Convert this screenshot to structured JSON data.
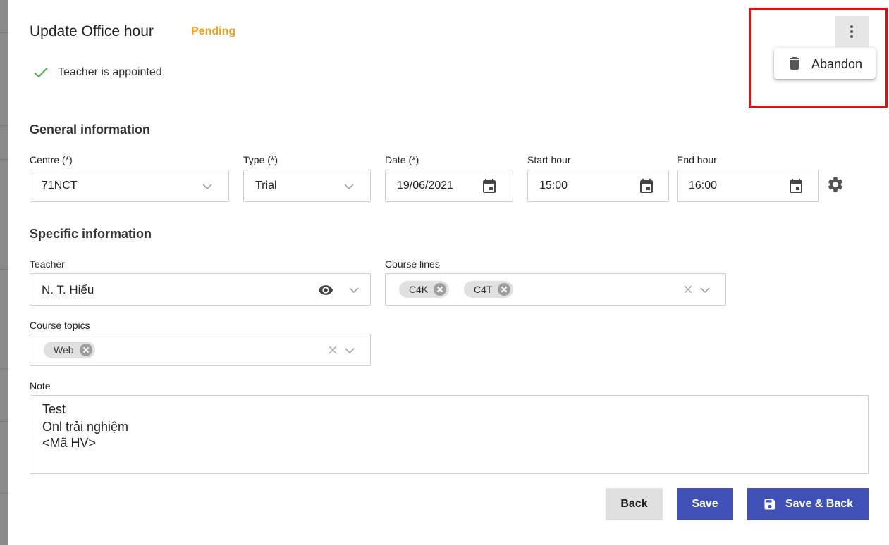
{
  "dialog": {
    "title": "Update Office hour",
    "status": "Pending",
    "appointed_text": "Teacher is appointed"
  },
  "general": {
    "section_title": "General information",
    "centre": {
      "label": "Centre (*)",
      "value": "71NCT"
    },
    "type": {
      "label": "Type (*)",
      "value": "Trial"
    },
    "date": {
      "label": "Date (*)",
      "value": "19/06/2021"
    },
    "start_hour": {
      "label": "Start hour",
      "value": "15:00"
    },
    "end_hour": {
      "label": "End hour",
      "value": "16:00"
    }
  },
  "specific": {
    "section_title": "Specific information",
    "teacher": {
      "label": "Teacher",
      "value": "N. T. Hiếu"
    },
    "course_lines": {
      "label": "Course lines",
      "chips": [
        "C4K",
        "C4T"
      ]
    },
    "course_topics": {
      "label": "Course topics",
      "chips": [
        "Web"
      ]
    }
  },
  "note": {
    "label": "Note",
    "lines": [
      "Test",
      "Onl trải nghiệm",
      "<Mã HV>"
    ]
  },
  "actions": {
    "back": "Back",
    "save": "Save",
    "save_back": "Save & Back"
  },
  "menu": {
    "abandon": "Abandon"
  },
  "colors": {
    "status": "#f0a016",
    "check": "#4caf50",
    "primary": "#3f51b5",
    "highlight": "#e01010"
  }
}
